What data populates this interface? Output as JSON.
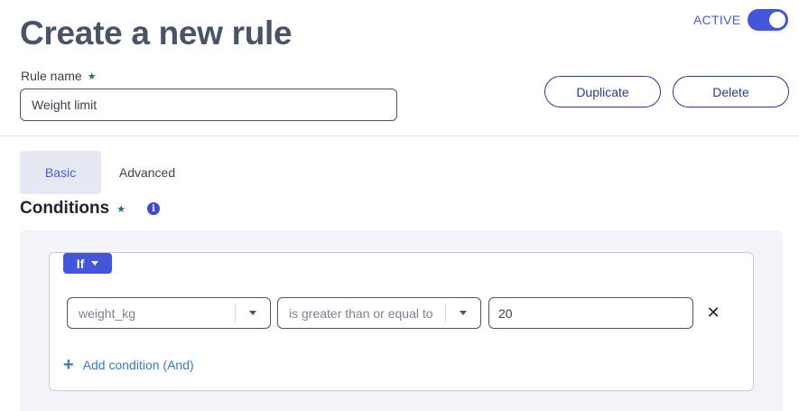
{
  "header": {
    "title": "Create a new rule",
    "active_label": "ACTIVE",
    "active_on": true
  },
  "rule_name": {
    "label": "Rule name",
    "required_icon": "star-icon",
    "value": "Weight limit"
  },
  "actions": {
    "duplicate_label": "Duplicate",
    "delete_label": "Delete"
  },
  "tabs": [
    {
      "label": "Basic",
      "selected": true
    },
    {
      "label": "Advanced",
      "selected": false
    }
  ],
  "conditions": {
    "title": "Conditions",
    "info_icon": "info-icon",
    "if_label": "If",
    "rows": [
      {
        "field": "weight_kg",
        "operator": "is greater than or equal to",
        "value": "20"
      }
    ],
    "add_label": "Add condition (And)"
  },
  "colors": {
    "accent": "#4355d9",
    "button_border": "#2a3a8c",
    "link": "#3a78c4",
    "panel_bg": "#f3f4f9",
    "required_star": "#1f6f73"
  }
}
